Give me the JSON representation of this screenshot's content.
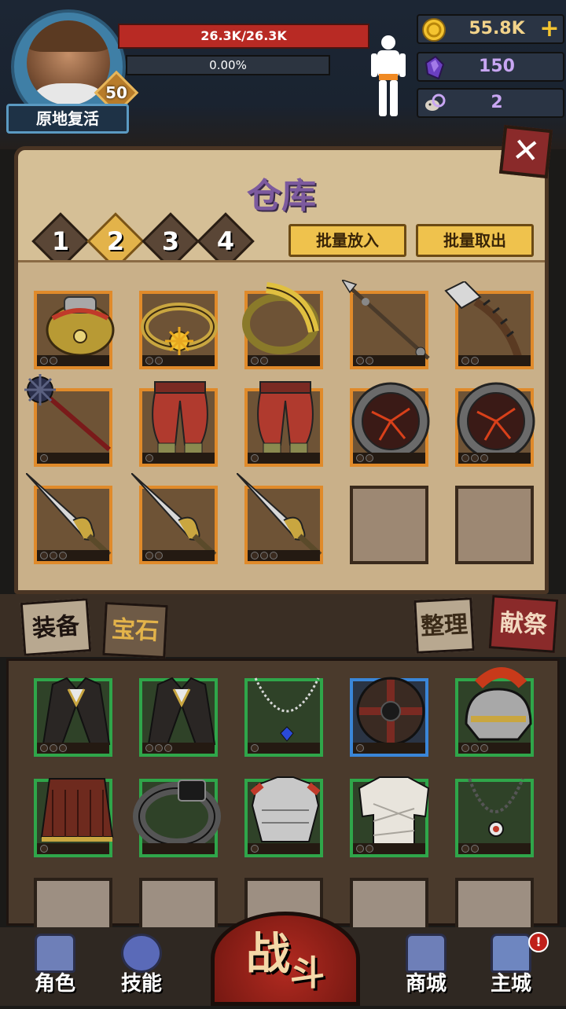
{
  "player": {
    "level": "50",
    "revive_label": "原地复活",
    "hp_text": "26.3K/26.3K",
    "xp_text": "0.00%"
  },
  "resources": [
    {
      "icon": "gold-coin-icon",
      "value": "55.8K",
      "has_plus": true
    },
    {
      "icon": "purple-crystal-icon",
      "value": "150"
    },
    {
      "icon": "ram-skull-icon",
      "value": "2"
    }
  ],
  "warehouse": {
    "title": "仓库",
    "pages": [
      "1",
      "2",
      "3",
      "4"
    ],
    "active_page": "2",
    "batch_in_label": "批量放入",
    "batch_out_label": "批量取出",
    "slots": [
      {
        "item": "golden-armor-icon"
      },
      {
        "item": "sun-ring-icon"
      },
      {
        "item": "golden-bracelet-icon"
      },
      {
        "item": "spear-icon"
      },
      {
        "item": "cleaver-icon"
      },
      {
        "item": "spiked-mace-icon"
      },
      {
        "item": "red-pants-icon"
      },
      {
        "item": "red-pants-icon"
      },
      {
        "item": "lava-shield-icon"
      },
      {
        "item": "lava-shield-icon"
      },
      {
        "item": "ornate-dagger-icon"
      },
      {
        "item": "ornate-dagger-icon"
      },
      {
        "item": "ornate-dagger-icon"
      },
      {
        "item": null
      },
      {
        "item": null
      }
    ]
  },
  "tabs": {
    "equipment": "装备",
    "gems": "宝石",
    "sort": "整理",
    "sacrifice": "献祭"
  },
  "inventory": {
    "slots": [
      {
        "item": "black-coat-icon",
        "rarity": "green"
      },
      {
        "item": "black-coat-icon",
        "rarity": "green"
      },
      {
        "item": "sapphire-necklace-icon",
        "rarity": "green"
      },
      {
        "item": "round-shield-icon",
        "rarity": "blue"
      },
      {
        "item": "roman-helmet-icon",
        "rarity": "green"
      },
      {
        "item": "leather-skirt-icon",
        "rarity": "green"
      },
      {
        "item": "black-ring-icon",
        "rarity": "green"
      },
      {
        "item": "steel-armor-icon",
        "rarity": "green"
      },
      {
        "item": "bandage-wrap-icon",
        "rarity": "green"
      },
      {
        "item": "chain-amulet-icon",
        "rarity": "green"
      },
      {
        "item": null,
        "rarity": "gray"
      },
      {
        "item": null,
        "rarity": "gray"
      },
      {
        "item": null,
        "rarity": "gray"
      },
      {
        "item": null,
        "rarity": "gray"
      },
      {
        "item": null,
        "rarity": "gray"
      }
    ]
  },
  "nav": {
    "character": "角色",
    "skills": "技能",
    "fight_1": "战",
    "fight_2": "斗",
    "shop": "商城",
    "main_city": "主城",
    "notification": "!"
  },
  "colors": {
    "hp": "#b82a24",
    "title": "#7c5a9e",
    "orange_rarity": "#e08a2a",
    "green_rarity": "#2fa64a",
    "blue_rarity": "#3a86d8",
    "gold_button": "#efc24d"
  }
}
